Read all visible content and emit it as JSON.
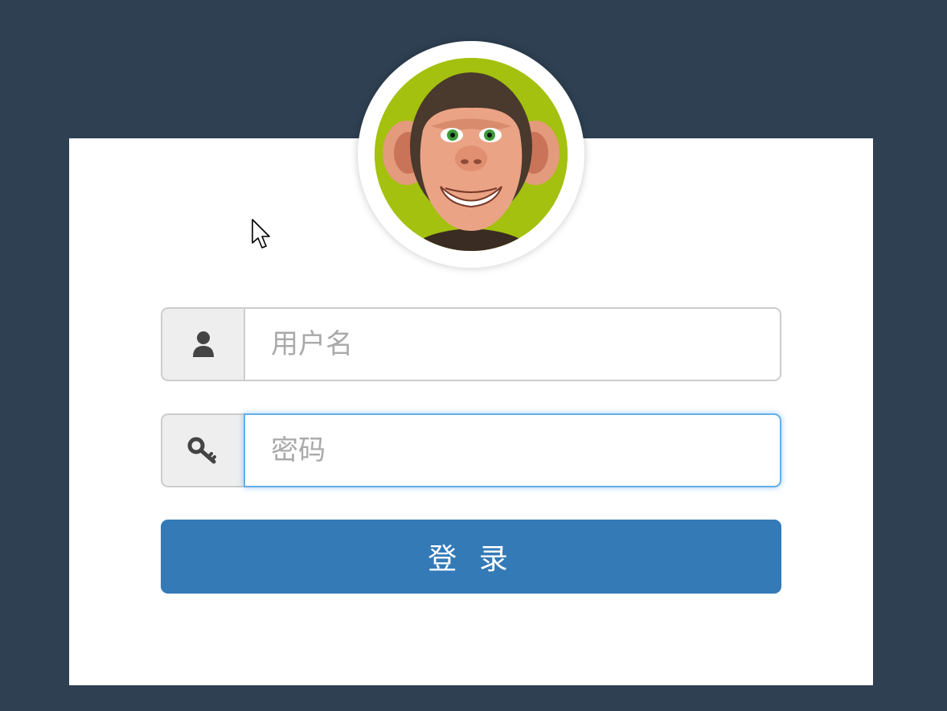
{
  "form": {
    "username_placeholder": "用户名",
    "password_placeholder": "密码",
    "login_label": "登 录"
  },
  "icons": {
    "username": "user-icon",
    "password": "key-icon",
    "avatar": "monkey-avatar"
  },
  "colors": {
    "page_background": "#2e4052",
    "button": "#337ab7",
    "avatar_background": "#a3c10e",
    "focus_border": "#66afe9"
  }
}
